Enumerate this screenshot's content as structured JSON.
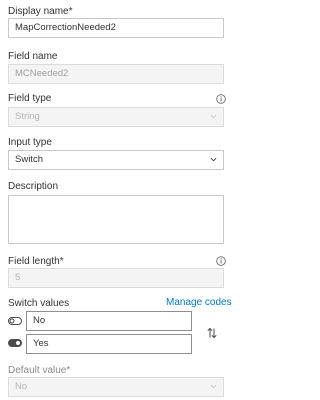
{
  "display_name": {
    "label": "Display name*",
    "value": "MapCorrectionNeeded2"
  },
  "field_name": {
    "label": "Field name",
    "value": "MCNeeded2"
  },
  "field_type": {
    "label": "Field type",
    "value": "String"
  },
  "input_type": {
    "label": "Input type",
    "value": "Switch"
  },
  "description": {
    "label": "Description",
    "value": ""
  },
  "field_length": {
    "label": "Field length*",
    "value": "5"
  },
  "switch_values": {
    "label": "Switch values",
    "manage_link": "Manage codes",
    "items": [
      {
        "value": "No",
        "icon": "toggle-off-icon"
      },
      {
        "value": "Yes",
        "icon": "toggle-on-icon"
      }
    ],
    "reorder_icon": "swap-vertical-icon"
  },
  "default_value": {
    "label": "Default value*",
    "value": "No"
  },
  "colors": {
    "accent": "#007ac2",
    "text": "#323232",
    "muted": "#8a8a8a",
    "border": "#c8c8c8",
    "disabled_bg": "#f4f4f4"
  }
}
